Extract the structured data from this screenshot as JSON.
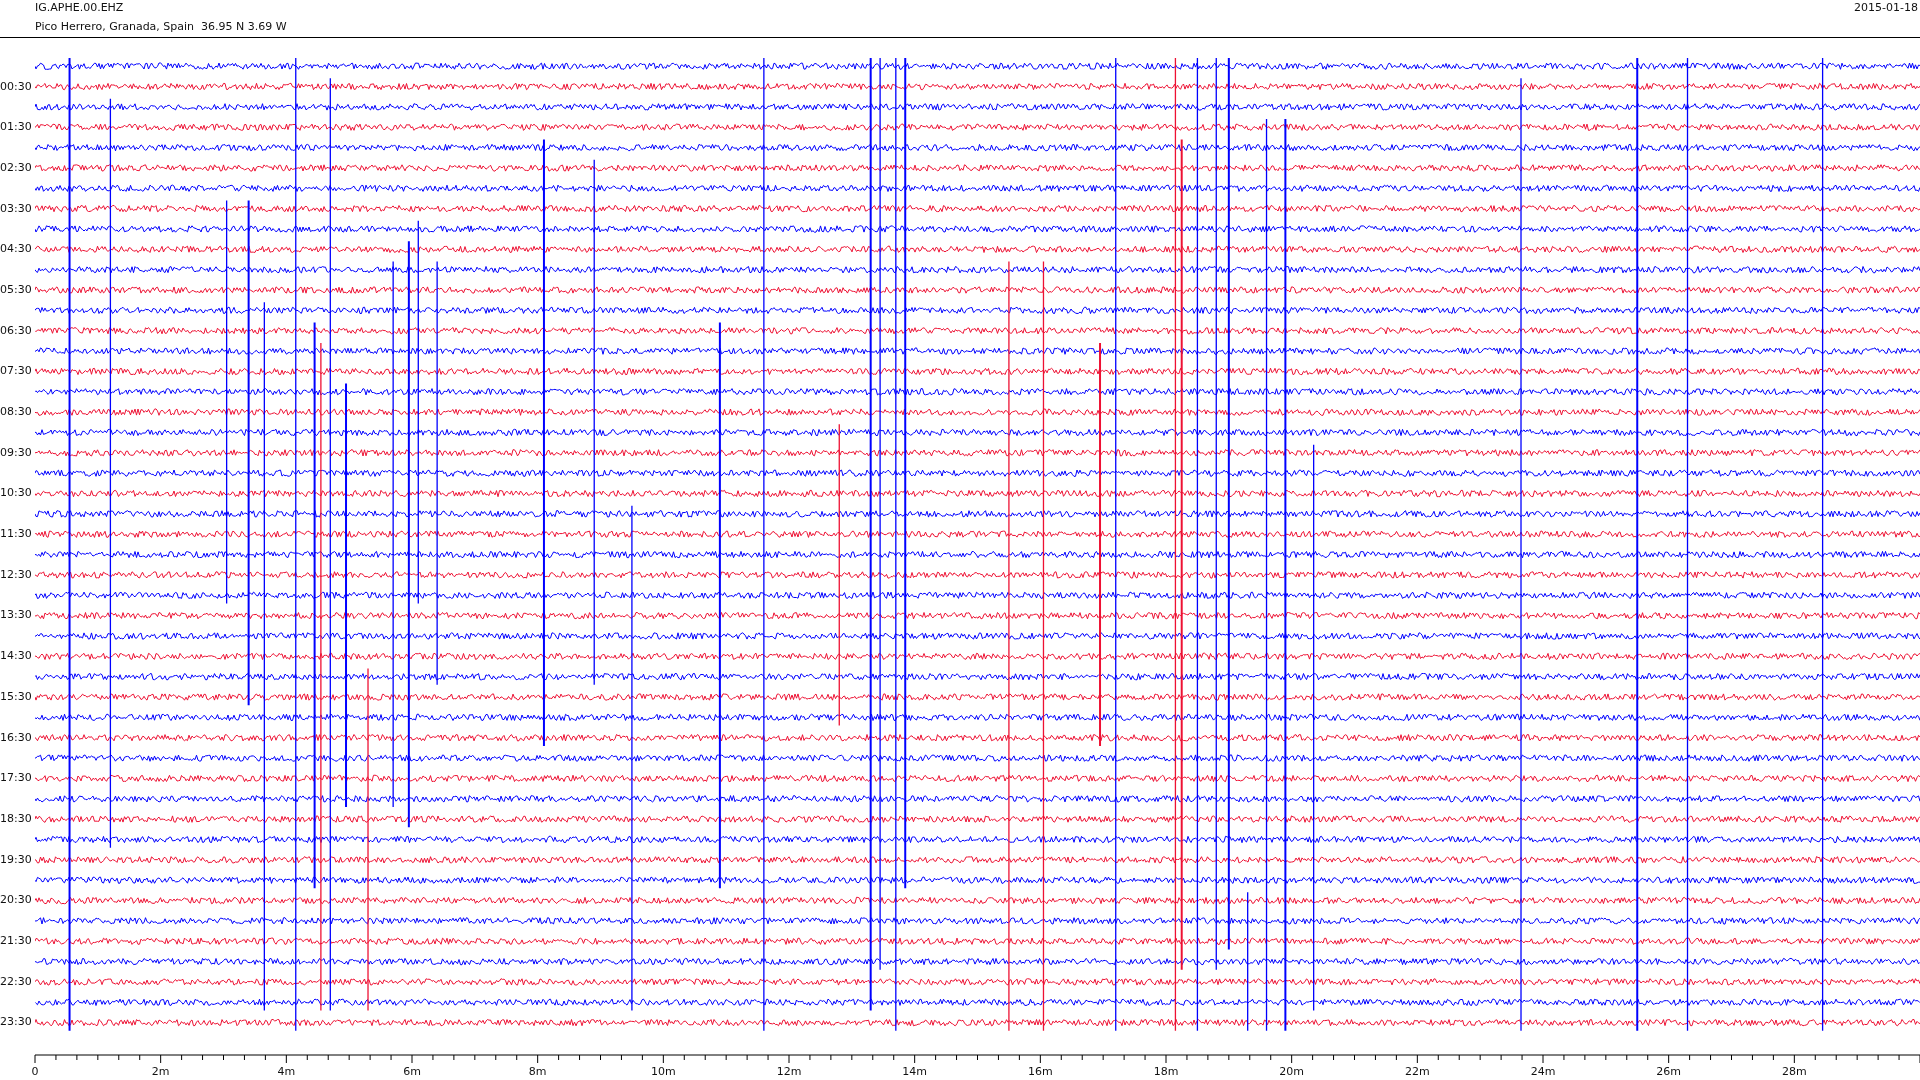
{
  "header": {
    "channel": "IG.APHE.00.EHZ",
    "location": "Pico Herrero, Granada, Spain  36.95 N 3.69 W",
    "date": "2015-01-18"
  },
  "traces": [
    {
      "color": "#0000ff"
    },
    {
      "label": "00:30",
      "color": "#ee1133"
    },
    {
      "color": "#0000ff"
    },
    {
      "label": "01:30",
      "color": "#ee1133"
    },
    {
      "color": "#0000ff"
    },
    {
      "label": "02:30",
      "color": "#ee1133"
    },
    {
      "color": "#0000ff"
    },
    {
      "label": "03:30",
      "color": "#ee1133"
    },
    {
      "color": "#0000ff"
    },
    {
      "label": "04:30",
      "color": "#ee1133"
    },
    {
      "color": "#0000ff"
    },
    {
      "label": "05:30",
      "color": "#ee1133"
    },
    {
      "color": "#0000ff"
    },
    {
      "label": "06:30",
      "color": "#ee1133"
    },
    {
      "color": "#0000ff"
    },
    {
      "label": "07:30",
      "color": "#ee1133"
    },
    {
      "color": "#0000ff"
    },
    {
      "label": "08:30",
      "color": "#ee1133"
    },
    {
      "color": "#0000ff"
    },
    {
      "label": "09:30",
      "color": "#ee1133"
    },
    {
      "color": "#0000ff"
    },
    {
      "label": "10:30",
      "color": "#ee1133"
    },
    {
      "color": "#0000ff"
    },
    {
      "label": "11:30",
      "color": "#ee1133"
    },
    {
      "color": "#0000ff"
    },
    {
      "label": "12:30",
      "color": "#ee1133"
    },
    {
      "color": "#0000ff"
    },
    {
      "label": "13:30",
      "color": "#ee1133"
    },
    {
      "color": "#0000ff"
    },
    {
      "label": "14:30",
      "color": "#ee1133"
    },
    {
      "color": "#0000ff"
    },
    {
      "label": "15:30",
      "color": "#ee1133"
    },
    {
      "color": "#0000ff"
    },
    {
      "label": "16:30",
      "color": "#ee1133"
    },
    {
      "color": "#0000ff"
    },
    {
      "label": "17:30",
      "color": "#ee1133"
    },
    {
      "color": "#0000ff"
    },
    {
      "label": "18:30",
      "color": "#ee1133"
    },
    {
      "color": "#0000ff"
    },
    {
      "label": "19:30",
      "color": "#ee1133"
    },
    {
      "color": "#0000ff"
    },
    {
      "label": "20:30",
      "color": "#ee1133"
    },
    {
      "color": "#0000ff"
    },
    {
      "label": "21:30",
      "color": "#ee1133"
    },
    {
      "color": "#0000ff"
    },
    {
      "label": "22:30",
      "color": "#ee1133"
    },
    {
      "color": "#0000ff"
    },
    {
      "label": "23:30",
      "color": "#ee1133"
    }
  ],
  "x_axis": {
    "ticks": [
      "0",
      "2m",
      "4m",
      "6m",
      "8m",
      "10m",
      "12m",
      "14m",
      "16m",
      "18m",
      "20m",
      "22m",
      "24m",
      "26m",
      "28m"
    ]
  }
}
